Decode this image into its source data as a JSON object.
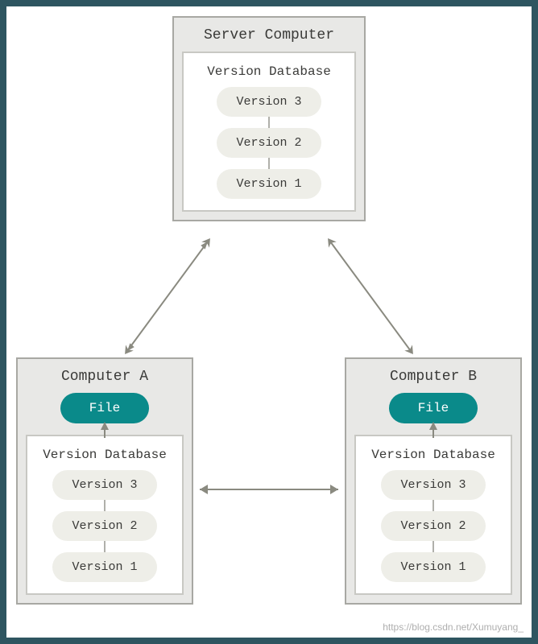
{
  "server": {
    "title": "Server Computer",
    "db_title": "Version Database",
    "versions": [
      "Version 3",
      "Version 2",
      "Version 1"
    ]
  },
  "computer_a": {
    "title": "Computer A",
    "file_label": "File",
    "db_title": "Version Database",
    "versions": [
      "Version 3",
      "Version 2",
      "Version 1"
    ]
  },
  "computer_b": {
    "title": "Computer B",
    "file_label": "File",
    "db_title": "Version Database",
    "versions": [
      "Version 3",
      "Version 2",
      "Version 1"
    ]
  },
  "watermark": "https://blog.csdn.net/Xumuyang_"
}
